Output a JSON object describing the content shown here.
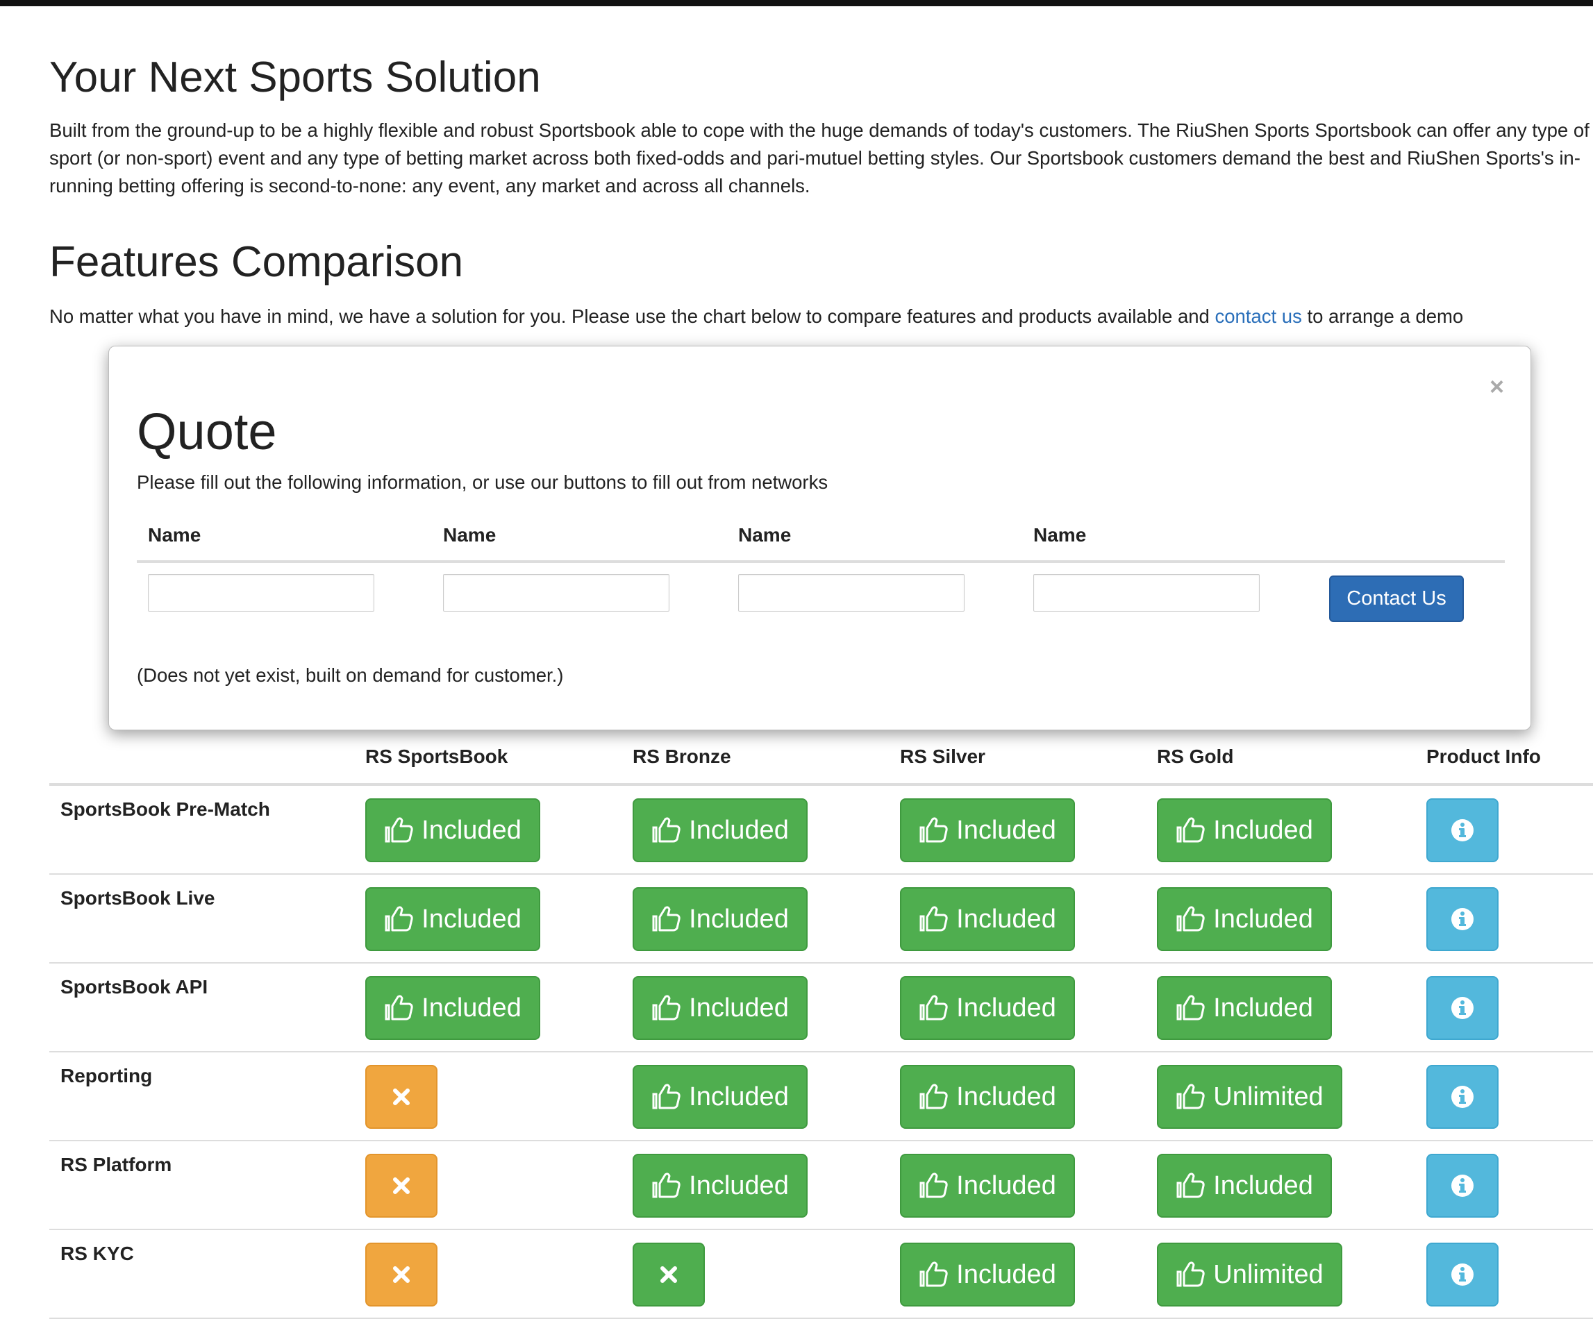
{
  "page": {
    "title": "Your Next Sports Solution",
    "intro": "Built from the ground-up to be a highly flexible and robust Sportsbook able to cope with the huge demands of today's customers. The RiuShen Sports Sportsbook can offer any type of sport (or non-sport) event and any type of betting market across both fixed-odds and pari-mutuel betting styles. Our Sportsbook customers demand the best and RiuShen Sports's in-running betting offering is second-to-none: any event, any market and across all channels.",
    "comparison_title": "Features Comparison",
    "comparison_desc_before": "No matter what you have in mind, we have a solution for you. Please use the chart below to compare features and products available and ",
    "comparison_link": "contact us",
    "comparison_desc_after": " to arrange a demo"
  },
  "modal": {
    "close": "×",
    "title": "Quote",
    "description": "Please fill out the following information, or use our buttons to fill out from networks",
    "field_labels": [
      "Name",
      "Name",
      "Name",
      "Name"
    ],
    "submit_label": "Contact Us",
    "note": "(Does not yet exist, built on demand for customer.)"
  },
  "features": {
    "columns": [
      "RS SportsBook",
      "RS Bronze",
      "RS Silver",
      "RS Gold",
      "Product Info"
    ],
    "rows": [
      {
        "label": "SportsBook Pre-Match",
        "cells": [
          "Included",
          "Included",
          "Included",
          "Included"
        ]
      },
      {
        "label": "SportsBook Live",
        "cells": [
          "Included",
          "Included",
          "Included",
          "Included"
        ]
      },
      {
        "label": "SportsBook API",
        "cells": [
          "Included",
          "Included",
          "Included",
          "Included"
        ]
      },
      {
        "label": "Reporting",
        "cells": [
          "x-orange",
          "Included",
          "Included",
          "Unlimited"
        ]
      },
      {
        "label": "RS Platform",
        "cells": [
          "x-orange",
          "Included",
          "Included",
          "Included"
        ]
      },
      {
        "label": "RS KYC",
        "cells": [
          "x-orange",
          "x-green",
          "Included",
          "Unlimited"
        ]
      }
    ],
    "included_icon": "thumbs-up-icon",
    "excluded_icon": "close-icon",
    "info_icon": "info-icon"
  },
  "colors": {
    "success": "#4fae4f",
    "warning": "#f0a63f",
    "info": "#53b8dc",
    "primary": "#2d6db5",
    "link": "#2a6fba"
  }
}
